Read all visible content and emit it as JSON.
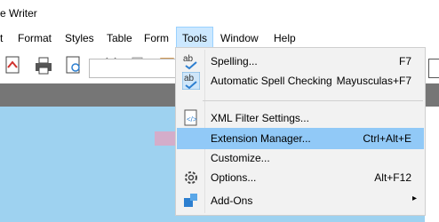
{
  "window": {
    "title": "e Writer"
  },
  "menubar": {
    "items": [
      "t",
      "Format",
      "Styles",
      "Table",
      "Form",
      "Tools",
      "Window",
      "Help"
    ]
  },
  "tools_menu": {
    "items": [
      {
        "label": "Spelling...",
        "shortcut": "F7",
        "icon": "spelling-icon"
      },
      {
        "label": "Automatic Spell Checking",
        "shortcut": "Mayusculas+F7",
        "icon": "auto-spellcheck-icon"
      },
      {
        "label": "XML Filter Settings...",
        "shortcut": "",
        "icon": "xml-filter-icon"
      },
      {
        "label": "Extension Manager...",
        "shortcut": "Ctrl+Alt+E",
        "icon": ""
      },
      {
        "label": "Customize...",
        "shortcut": "",
        "icon": ""
      },
      {
        "label": "Options...",
        "shortcut": "Alt+F12",
        "icon": "gear-icon"
      },
      {
        "label": "Add-Ons",
        "shortcut": "",
        "icon": "addons-icon",
        "submenu_arrow": "▸"
      }
    ]
  },
  "colors": {
    "menu_highlight": "#91c9f7",
    "document_bg": "#9ed2f0",
    "toolbar_band": "#767676"
  }
}
